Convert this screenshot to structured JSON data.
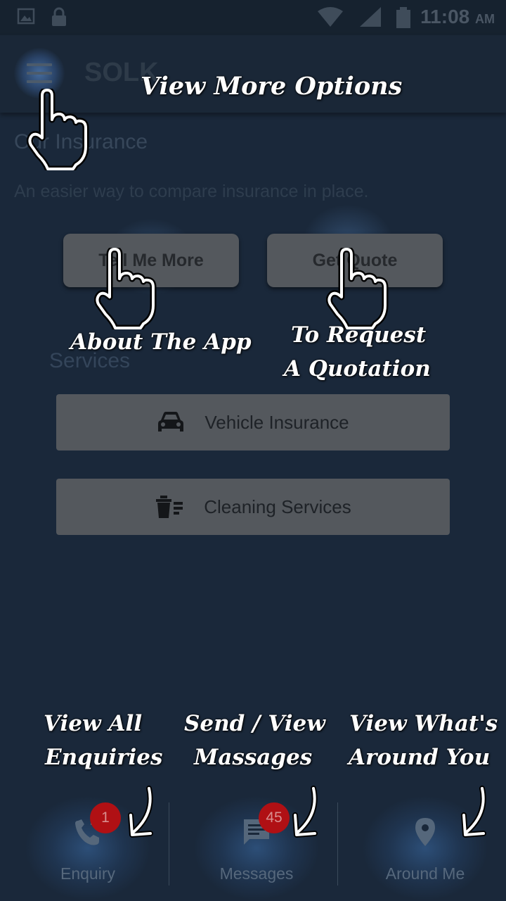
{
  "status_bar": {
    "time": "11:08",
    "ampm": "AM",
    "icons": [
      "image-icon",
      "lock-icon",
      "wifi-icon",
      "signal-icon",
      "battery-icon"
    ]
  },
  "app_bar": {
    "title": "SOLK",
    "menu_icon": "hamburger-menu-icon"
  },
  "main": {
    "heading": "Our Insurance",
    "tagline": "An easier way to compare insurance in place.",
    "buttons": {
      "tell_me_more": "Tell Me More",
      "get_quote": "Get Quote"
    },
    "services_label": "Services",
    "services": [
      {
        "label": "Vehicle Insurance",
        "icon": "car-icon"
      },
      {
        "label": "Cleaning Services",
        "icon": "trash-list-icon"
      }
    ]
  },
  "bottom_nav": {
    "items": [
      {
        "label": "Enquiry",
        "icon": "phone-forward-icon",
        "badge": "1"
      },
      {
        "label": "Messages",
        "icon": "message-icon",
        "badge": "45"
      },
      {
        "label": "Around Me",
        "icon": "location-pin-icon"
      }
    ]
  },
  "tutorial": {
    "menu_note": "View More Options",
    "tell_note": "About The App",
    "quote_note_line1": "To Request",
    "quote_note_line2": "A Quotation",
    "enquiry_note_line1": "View All",
    "enquiry_note_line2": "Enquiries",
    "messages_note_line1": "Send / View",
    "messages_note_line2": "Massages",
    "around_note_line1": "View What's",
    "around_note_line2": "Around You"
  },
  "colors": {
    "background": "#1a283a",
    "button_gray": "#54585d",
    "badge_red": "#b01014",
    "overlay_text": "#ffffff"
  }
}
